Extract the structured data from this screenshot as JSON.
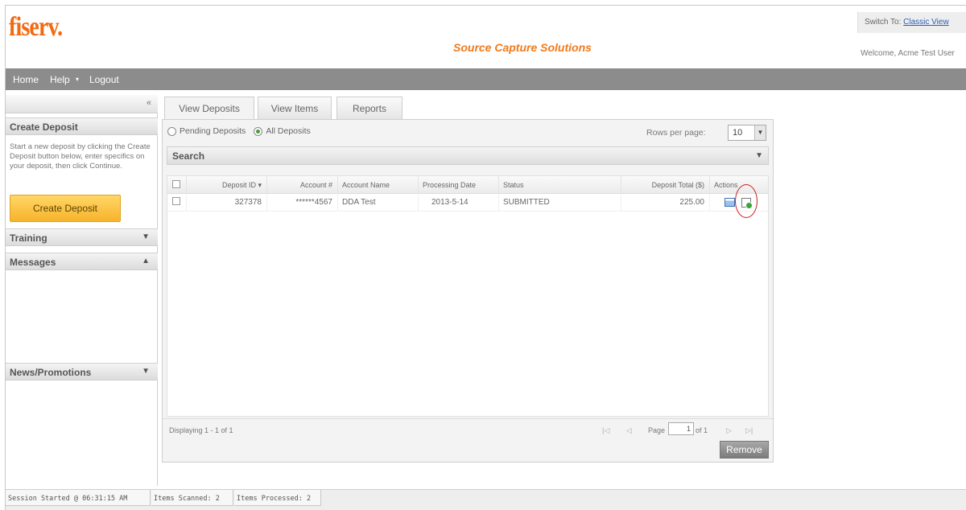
{
  "header": {
    "logo": "fiserv.",
    "app_title": "Source Capture Solutions",
    "switch_label": "Switch To:",
    "switch_link": "Classic View",
    "welcome": "Welcome, Acme Test User"
  },
  "nav": {
    "home": "Home",
    "help": "Help",
    "help_arrow": "▾",
    "logout": "Logout"
  },
  "sidebar": {
    "collapse_arrow": "«",
    "create_deposit": {
      "title": "Create Deposit",
      "description": "Start a new deposit by clicking the Create Deposit button below, enter specifics on your deposit, then click Continue.",
      "button": "Create Deposit"
    },
    "training": {
      "title": "Training",
      "arrow": "▼"
    },
    "messages": {
      "title": "Messages",
      "arrow": "▲"
    },
    "news": {
      "title": "News/Promotions",
      "arrow": "▼"
    }
  },
  "tabs": [
    {
      "label": "View Deposits"
    },
    {
      "label": "View Items"
    },
    {
      "label": "Reports"
    }
  ],
  "filter": {
    "pending_label": "Pending Deposits",
    "all_label": "All Deposits",
    "rows_per_page_label": "Rows per page:",
    "rows_per_page_value": "10"
  },
  "search": {
    "label": "Search",
    "arrow": "▼"
  },
  "grid": {
    "columns": [
      "Deposit ID ▾",
      "Account #",
      "Account Name",
      "Processing Date",
      "Status",
      "Deposit Total ($)",
      "Actions"
    ],
    "rows": [
      {
        "deposit_id": "327378",
        "account": "******4567",
        "account_name": "DDA Test",
        "processing_date": "2013-5-14",
        "status": "SUBMITTED",
        "deposit_total": "225.00"
      }
    ]
  },
  "pager": {
    "displaying": "Displaying 1 - 1 of 1",
    "first": "|◁",
    "prev": "◁",
    "page_label": "Page",
    "page_value": "1",
    "of_label": "of 1",
    "next": "▷",
    "last": "▷|"
  },
  "remove_button": "Remove",
  "status": {
    "session": "Session Started @ 06:31:15 AM",
    "scanned": "Items Scanned: 2",
    "processed": "Items Processed: 2"
  }
}
